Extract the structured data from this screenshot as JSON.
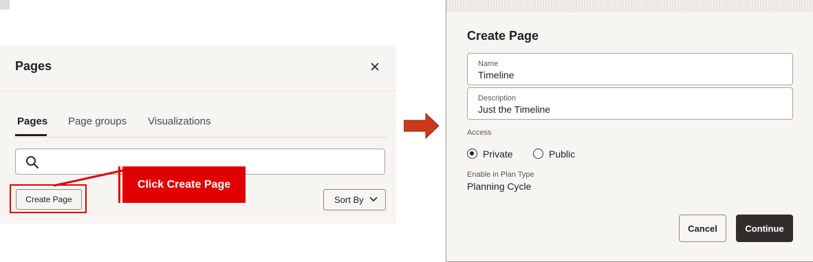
{
  "pages_panel": {
    "title": "Pages",
    "close_icon": "close-icon",
    "tabs": [
      {
        "label": "Pages",
        "active": true
      },
      {
        "label": "Page groups",
        "active": false
      },
      {
        "label": "Visualizations",
        "active": false
      }
    ],
    "search": {
      "icon": "search-icon",
      "value": ""
    },
    "create_page_label": "Create Page",
    "sort_by_label": "Sort By",
    "sort_icon": "chevron-down-icon"
  },
  "annotation": {
    "callout_text": "Click Create Page",
    "color": "#e00000",
    "arrow_color": "#cc3a1a"
  },
  "create_page_dialog": {
    "title": "Create Page",
    "name": {
      "label": "Name",
      "value": "Timeline"
    },
    "description": {
      "label": "Description",
      "value": "Just the Timeline"
    },
    "access": {
      "label": "Access",
      "options": [
        {
          "label": "Private",
          "checked": true
        },
        {
          "label": "Public",
          "checked": false
        }
      ]
    },
    "plan_type": {
      "label": "Enable in Plan Type",
      "value": "Planning Cycle"
    },
    "cancel_label": "Cancel",
    "continue_label": "Continue",
    "continue_color": "#312d2a"
  }
}
